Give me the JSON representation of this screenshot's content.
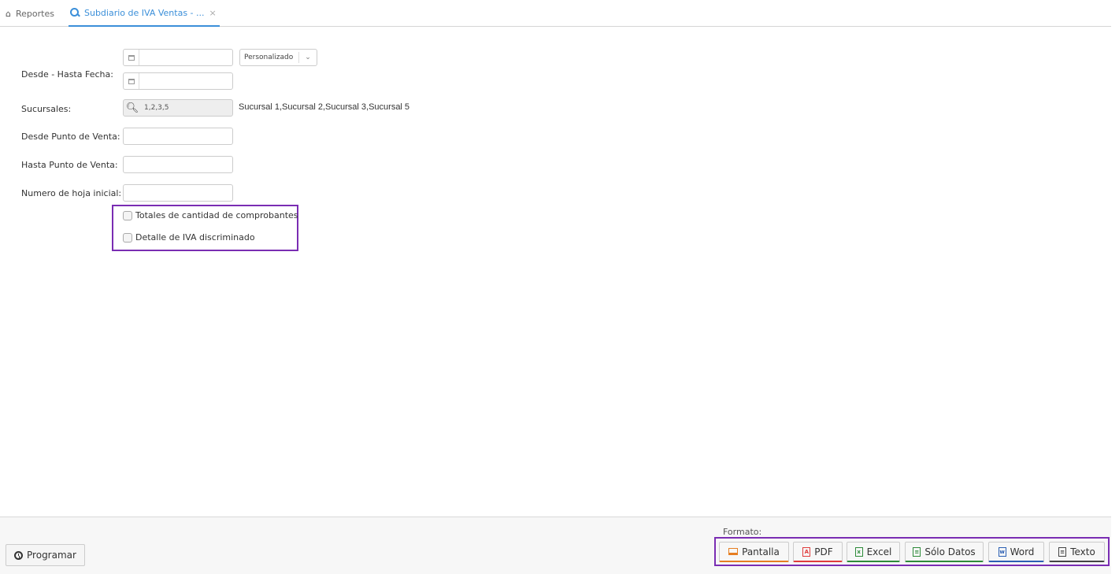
{
  "tabs": {
    "home_label": "Reportes",
    "active_label": "Subdiario de IVA Ventas - ...",
    "close_glyph": "×"
  },
  "form": {
    "fecha_label": "Desde - Hasta Fecha:",
    "fecha_desde_value": "",
    "fecha_hasta_value": "",
    "periodo_selected": "Personalizado",
    "sucursales_label": "Sucursales:",
    "sucursales_value": "1,2,3,5",
    "sucursales_text": "Sucursal 1,Sucursal 2,Sucursal 3,Sucursal 5",
    "desde_pv_label": "Desde Punto de Venta:",
    "desde_pv_value": "",
    "hasta_pv_label": "Hasta Punto de Venta:",
    "hasta_pv_value": "",
    "hoja_label": "Numero de hoja inicial:",
    "hoja_value": "",
    "chk_totales_label": "Totales de cantidad de comprobantes",
    "chk_totales_checked": false,
    "chk_detalle_label": "Detalle de IVA discriminado",
    "chk_detalle_checked": false
  },
  "footer": {
    "programar_label": "Programar",
    "formato_label": "Formato:",
    "buttons": [
      {
        "label": "Pantalla",
        "icon": "laptop-icon",
        "color": "#e67e22"
      },
      {
        "label": "PDF",
        "icon": "pdf-icon",
        "color": "#e03c3c"
      },
      {
        "label": "Excel",
        "icon": "excel-icon",
        "color": "#2e8b3a"
      },
      {
        "label": "Sólo Datos",
        "icon": "datos-icon",
        "color": "#2e8b3a"
      },
      {
        "label": "Word",
        "icon": "word-icon",
        "color": "#2b5fb3"
      },
      {
        "label": "Texto",
        "icon": "text-icon",
        "color": "#444444"
      }
    ]
  },
  "colors": {
    "accent": "#3b8fd9",
    "highlight_box": "#7a2db3"
  }
}
